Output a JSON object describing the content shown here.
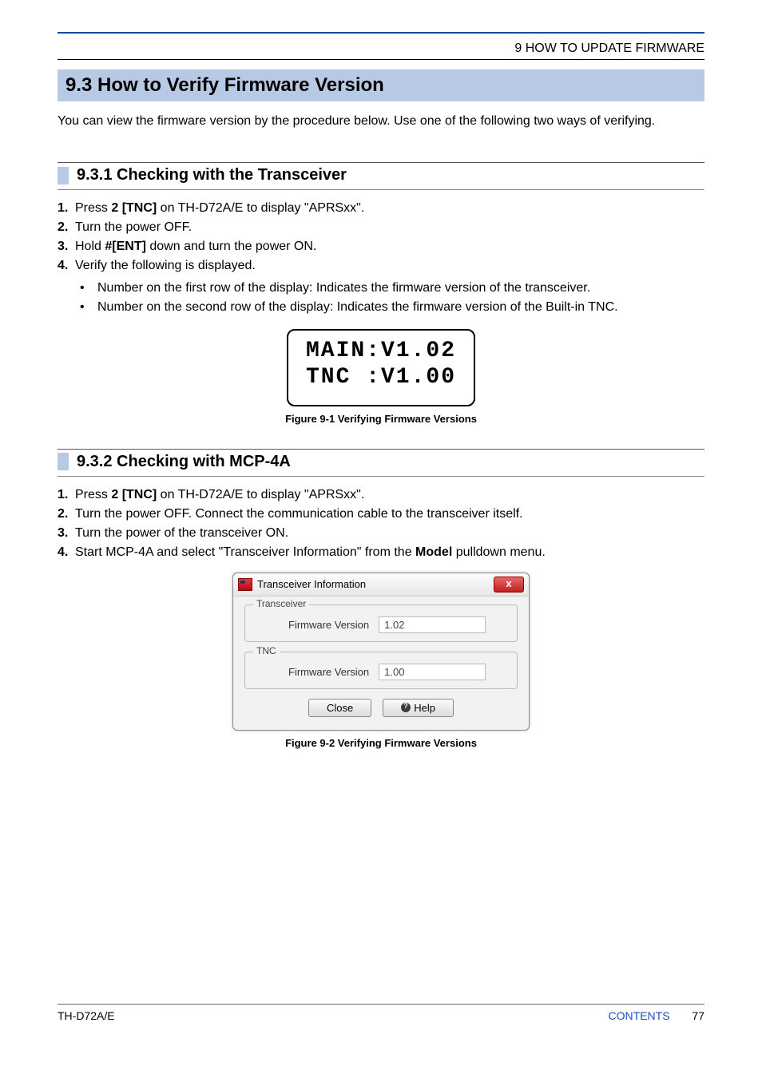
{
  "header": {
    "chapter_title": "9 HOW TO UPDATE FIRMWARE"
  },
  "section": {
    "bar_text": "9.3  How to Verify Firmware Version",
    "intro": "You can view the firmware version by the procedure below.  Use one of the following two ways of verifying."
  },
  "sub1": {
    "title": "9.3.1  Checking with the Transceiver",
    "steps": [
      {
        "num": "1.",
        "pre": "Press ",
        "bold": "2 [TNC]",
        "post": " on TH-D72A/E to display \"APRSxx\"."
      },
      {
        "num": "2.",
        "pre": "Turn the power OFF.",
        "bold": "",
        "post": ""
      },
      {
        "num": "3.",
        "pre": "Hold ",
        "bold": "#[ENT]",
        "post": " down and turn the power ON."
      },
      {
        "num": "4.",
        "pre": "Verify the following is displayed.",
        "bold": "",
        "post": ""
      }
    ],
    "bullets": [
      "Number on the first row of the display: Indicates the firmware version of the transceiver.",
      "Number on the second row of the display: Indicates the firmware version of the Built-in TNC."
    ],
    "lcd_line1": "MAIN:V1.02",
    "lcd_line2": "TNC :V1.00",
    "fig_caption": "Figure 9-1  Verifying Firmware Versions"
  },
  "sub2": {
    "title": "9.3.2  Checking with MCP-4A",
    "steps": [
      {
        "num": "1.",
        "pre": "Press ",
        "bold": "2 [TNC]",
        "post": " on TH-D72A/E to display \"APRSxx\"."
      },
      {
        "num": "2.",
        "pre": "Turn the power OFF.  Connect the communication cable to the transceiver itself.",
        "bold": "",
        "post": ""
      },
      {
        "num": "3.",
        "pre": "Turn the power of the transceiver ON.",
        "bold": "",
        "post": ""
      },
      {
        "num": "4.",
        "pre": "Start MCP-4A and select \"Transceiver Information\" from the ",
        "bold": "Model",
        "post": " pulldown menu."
      }
    ],
    "dialog": {
      "title": "Transceiver Information",
      "group1_legend": "Transceiver",
      "group2_legend": "TNC",
      "fw_label": "Firmware Version",
      "fw1": "1.02",
      "fw2": "1.00",
      "btn_close": "Close",
      "btn_help": "Help"
    },
    "fig_caption": "Figure 9-2  Verifying Firmware Versions"
  },
  "footer": {
    "model": "TH-D72A/E",
    "contents": "CONTENTS",
    "page": "77"
  }
}
